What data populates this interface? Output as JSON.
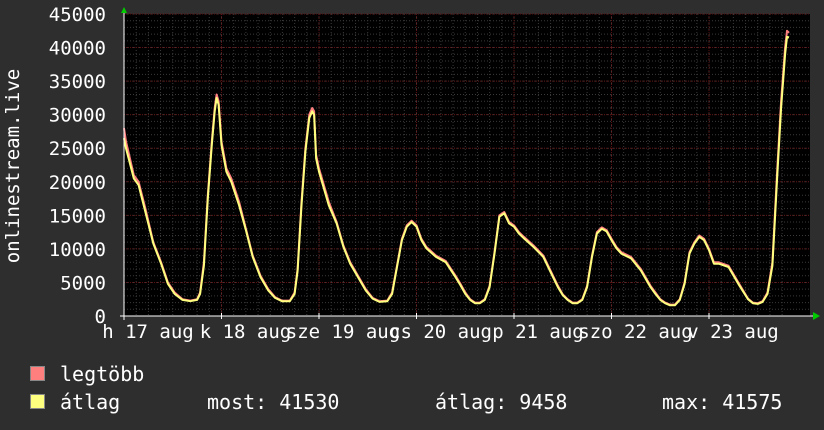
{
  "chart_data": {
    "type": "line",
    "title": "",
    "ylabel": "onlinestream.live",
    "ylim": [
      0,
      45000
    ],
    "yticks": [
      0,
      5000,
      10000,
      15000,
      20000,
      25000,
      30000,
      35000,
      40000,
      45000
    ],
    "xticks": [
      {
        "label": "h 17 aug",
        "x": 0
      },
      {
        "label": "k 18 aug",
        "x": 1
      },
      {
        "label": "sze 19 aug",
        "x": 2
      },
      {
        "label": "cs 20 aug",
        "x": 3
      },
      {
        "label": "p 21 aug",
        "x": 4
      },
      {
        "label": "szo 22 aug",
        "x": 5
      },
      {
        "label": "v 23 aug",
        "x": 6
      }
    ],
    "xlim": [
      0,
      6.85
    ],
    "grid": true,
    "series": [
      {
        "name": "legtöbb",
        "color": "#ff7f7f",
        "x": [
          0.0,
          0.02,
          0.1,
          0.15,
          0.22,
          0.3,
          0.38,
          0.45,
          0.52,
          0.6,
          0.68,
          0.75,
          0.78,
          0.82,
          0.86,
          0.9,
          0.93,
          0.95,
          0.97,
          1.0,
          1.05,
          1.1,
          1.18,
          1.25,
          1.32,
          1.4,
          1.48,
          1.55,
          1.62,
          1.7,
          1.75,
          1.78,
          1.82,
          1.86,
          1.9,
          1.93,
          1.95,
          1.97,
          2.0,
          2.05,
          2.1,
          2.18,
          2.25,
          2.32,
          2.4,
          2.48,
          2.55,
          2.62,
          2.7,
          2.75,
          2.8,
          2.85,
          2.9,
          2.95,
          3.0,
          3.05,
          3.1,
          3.2,
          3.3,
          3.4,
          3.45,
          3.5,
          3.55,
          3.6,
          3.65,
          3.7,
          3.75,
          3.8,
          3.85,
          3.9,
          3.95,
          4.0,
          4.05,
          4.1,
          4.2,
          4.3,
          4.4,
          4.45,
          4.5,
          4.55,
          4.6,
          4.65,
          4.7,
          4.75,
          4.8,
          4.85,
          4.9,
          4.95,
          5.0,
          5.05,
          5.1,
          5.2,
          5.3,
          5.4,
          5.45,
          5.5,
          5.55,
          5.6,
          5.65,
          5.7,
          5.75,
          5.8,
          5.85,
          5.9,
          5.95,
          6.0,
          6.05,
          6.1,
          6.2,
          6.3,
          6.4,
          6.45,
          6.5,
          6.55,
          6.6,
          6.65,
          6.7,
          6.74,
          6.78,
          6.8,
          6.82
        ],
        "values": [
          28000,
          26000,
          21000,
          20000,
          16000,
          11000,
          8000,
          5000,
          3500,
          2500,
          2300,
          2500,
          3500,
          8000,
          18000,
          26000,
          31000,
          33000,
          32000,
          26000,
          22000,
          20500,
          17000,
          13000,
          9000,
          6000,
          4000,
          2800,
          2300,
          2300,
          3500,
          7000,
          17000,
          25000,
          30000,
          31000,
          30500,
          24000,
          22000,
          19500,
          17000,
          14000,
          10500,
          8000,
          6000,
          4000,
          2700,
          2200,
          2300,
          3500,
          7500,
          11500,
          13500,
          14200,
          13500,
          11500,
          10300,
          9000,
          8200,
          6000,
          4800,
          3500,
          2500,
          2000,
          2000,
          2500,
          4500,
          9500,
          15000,
          15500,
          14000,
          13500,
          12500,
          11800,
          10500,
          9000,
          6000,
          4500,
          3200,
          2500,
          2000,
          2000,
          2500,
          4500,
          9000,
          12500,
          13200,
          12800,
          11500,
          10300,
          9500,
          8800,
          7000,
          4500,
          3500,
          2500,
          2000,
          1700,
          1700,
          2500,
          5000,
          9500,
          11000,
          12000,
          11500,
          10000,
          8000,
          8000,
          7500,
          5000,
          2600,
          2000,
          1900,
          2200,
          3500,
          8000,
          22000,
          32000,
          40000,
          42500,
          42200
        ]
      },
      {
        "name": "átlag",
        "color": "#ffff7f",
        "x": [
          0.0,
          0.02,
          0.1,
          0.15,
          0.22,
          0.3,
          0.38,
          0.45,
          0.52,
          0.6,
          0.68,
          0.75,
          0.78,
          0.82,
          0.86,
          0.9,
          0.93,
          0.95,
          0.97,
          1.0,
          1.05,
          1.1,
          1.18,
          1.25,
          1.32,
          1.4,
          1.48,
          1.55,
          1.62,
          1.7,
          1.75,
          1.78,
          1.82,
          1.86,
          1.9,
          1.93,
          1.95,
          1.97,
          2.0,
          2.05,
          2.1,
          2.18,
          2.25,
          2.32,
          2.4,
          2.48,
          2.55,
          2.62,
          2.7,
          2.75,
          2.8,
          2.85,
          2.9,
          2.95,
          3.0,
          3.05,
          3.1,
          3.2,
          3.3,
          3.4,
          3.45,
          3.5,
          3.55,
          3.6,
          3.65,
          3.7,
          3.75,
          3.8,
          3.85,
          3.9,
          3.95,
          4.0,
          4.05,
          4.1,
          4.2,
          4.3,
          4.4,
          4.45,
          4.5,
          4.55,
          4.6,
          4.65,
          4.7,
          4.75,
          4.8,
          4.85,
          4.9,
          4.95,
          5.0,
          5.05,
          5.1,
          5.2,
          5.3,
          5.4,
          5.45,
          5.5,
          5.55,
          5.6,
          5.65,
          5.7,
          5.75,
          5.8,
          5.85,
          5.9,
          5.95,
          6.0,
          6.05,
          6.1,
          6.2,
          6.3,
          6.4,
          6.45,
          6.5,
          6.55,
          6.6,
          6.65,
          6.7,
          6.74,
          6.78,
          6.8,
          6.82
        ],
        "values": [
          26500,
          25000,
          20500,
          19500,
          15500,
          10800,
          7800,
          4800,
          3300,
          2400,
          2200,
          2400,
          3300,
          7500,
          17500,
          25500,
          30500,
          32500,
          31500,
          25500,
          21500,
          20000,
          16500,
          12800,
          8800,
          5800,
          3800,
          2700,
          2200,
          2200,
          3300,
          6700,
          16500,
          24500,
          29500,
          30500,
          30000,
          23500,
          21500,
          19000,
          16500,
          13800,
          10300,
          7800,
          5800,
          3800,
          2600,
          2100,
          2200,
          3300,
          7300,
          11300,
          13300,
          14000,
          13300,
          11300,
          10100,
          8800,
          8000,
          5800,
          4600,
          3300,
          2400,
          1900,
          1900,
          2400,
          4300,
          9300,
          14800,
          15300,
          13800,
          13300,
          12300,
          11600,
          10300,
          8800,
          5800,
          4300,
          3100,
          2400,
          1900,
          1900,
          2400,
          4300,
          8800,
          12300,
          13000,
          12600,
          11300,
          10100,
          9300,
          8600,
          6800,
          4300,
          3300,
          2400,
          1900,
          1600,
          1600,
          2400,
          4800,
          9300,
          10800,
          11800,
          11300,
          9800,
          7800,
          7800,
          7300,
          4800,
          2500,
          1900,
          1800,
          2100,
          3300,
          7500,
          21000,
          31000,
          39000,
          41600,
          41500
        ]
      }
    ]
  },
  "legend": {
    "items": [
      {
        "label": "legtöbb",
        "color": "#ff7f7f"
      },
      {
        "label": "átlag",
        "color": "#ffff7f"
      }
    ],
    "stats": {
      "current": "most: 41530",
      "average": "átlag: 9458",
      "max": "max: 41575"
    }
  },
  "colors": {
    "background": "#2e2e2e",
    "plot_background": "#000000",
    "grid_major": "#5a1010",
    "grid_minor": "#3a3a3a",
    "axis": "#ffffff",
    "arrow": "#00cc00"
  }
}
